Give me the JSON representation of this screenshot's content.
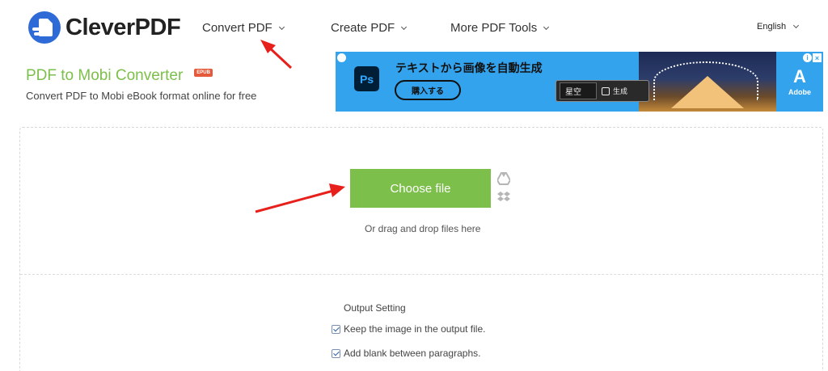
{
  "header": {
    "logo_text": "CleverPDF",
    "logo_badge": "PDF",
    "nav": [
      {
        "label": "Convert PDF"
      },
      {
        "label": "Create PDF"
      },
      {
        "label": "More PDF Tools"
      }
    ],
    "language": "English"
  },
  "page": {
    "title": "PDF to Mobi Converter",
    "badge": "EPUB",
    "subtitle": "Convert PDF to Mobi eBook format online for free"
  },
  "ad": {
    "app_icon": "Ps",
    "headline": "テキストから画像を自動生成",
    "buy_label": "購入する",
    "search_value": "星空",
    "generate_label": "生成",
    "brand": "Adobe",
    "colors": {
      "background": "#33a3ee"
    }
  },
  "upload": {
    "choose_label": "Choose file",
    "drop_hint": "Or drag and drop files here",
    "icons": [
      "google-drive-icon",
      "dropbox-icon"
    ]
  },
  "output": {
    "title": "Output Setting",
    "options": [
      {
        "label": "Keep the image in the output file.",
        "checked": true
      },
      {
        "label": "Add blank between paragraphs.",
        "checked": true
      }
    ]
  },
  "colors": {
    "accent": "#7cbf4a",
    "annotation_arrow": "#e8201c",
    "badge": "#e55a3b"
  }
}
